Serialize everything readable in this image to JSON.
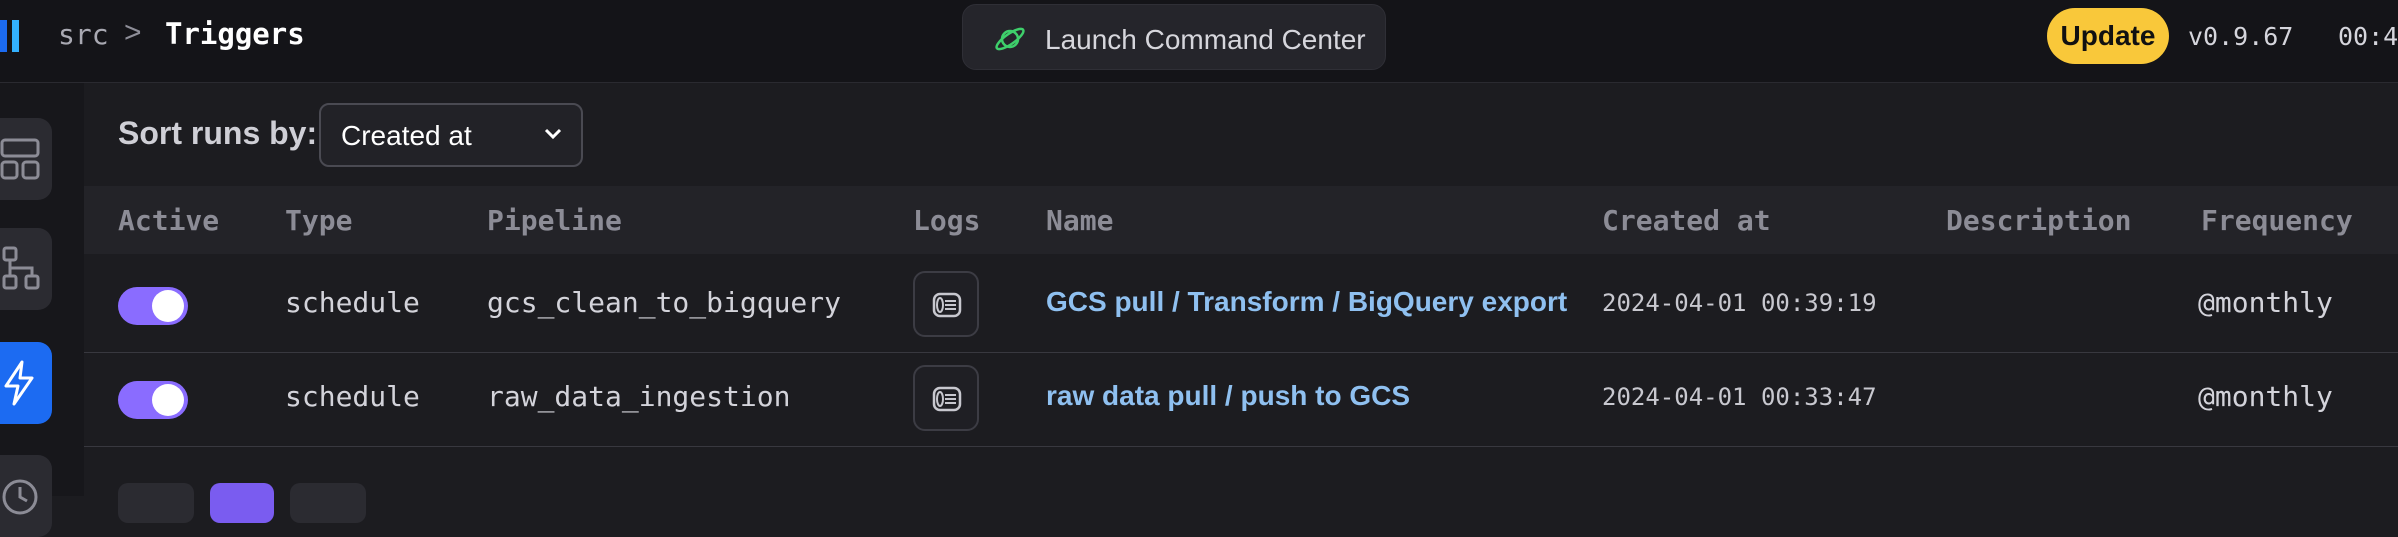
{
  "header": {
    "breadcrumb_root": "src",
    "breadcrumb_separator": ">",
    "breadcrumb_current": "Triggers",
    "command_center_label": "Launch Command Center",
    "update_label": "Update",
    "version": "v0.9.67",
    "clock": "00:4"
  },
  "sort": {
    "label": "Sort runs by:",
    "selected": "Created at"
  },
  "table": {
    "columns": [
      "Active",
      "Type",
      "Pipeline",
      "Logs",
      "Name",
      "Created at",
      "Description",
      "Frequency"
    ],
    "rows": [
      {
        "active": true,
        "type": "schedule",
        "pipeline": "gcs_clean_to_bigquery",
        "name": "GCS pull / Transform / BigQuery export",
        "created_at": "2024-04-01 00:39:19",
        "description": "",
        "frequency": "@monthly"
      },
      {
        "active": true,
        "type": "schedule",
        "pipeline": "raw_data_ingestion",
        "name": "raw data pull / push to GCS",
        "created_at": "2024-04-01 00:33:47",
        "description": "",
        "frequency": "@monthly"
      }
    ]
  },
  "icons": {
    "logo": "mage-logo",
    "command_center": "planet-icon",
    "nav": [
      "layout-icon",
      "pipeline-tree-icon",
      "lightning-icon",
      "clock-icon"
    ],
    "logs": "logs-icon",
    "dropdown": "chevron-down-icon"
  },
  "colors": {
    "accent_purple": "#8a6cff",
    "nav_active": "#1c6bf2",
    "update_yellow": "#f9c83a",
    "link_blue": "#8fc0f0"
  }
}
